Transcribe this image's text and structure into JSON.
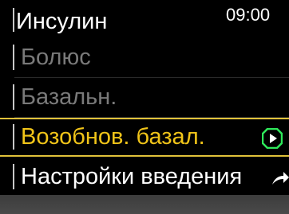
{
  "header": {
    "title": "Инсулин",
    "time": "09:00"
  },
  "menu": {
    "items": [
      {
        "label": "Болюс",
        "state": "disabled"
      },
      {
        "label": "Базальн.",
        "state": "disabled"
      },
      {
        "label": "Возобнов. базал.",
        "state": "selected",
        "icon": "play-circle-icon"
      },
      {
        "label": "Настройки введения",
        "state": "normal",
        "icon": "arrow-icon"
      }
    ]
  },
  "colors": {
    "highlight": "#f0c419",
    "play_icon": "#2ee85a",
    "disabled_text": "#7a7a7a",
    "background": "#000000"
  }
}
